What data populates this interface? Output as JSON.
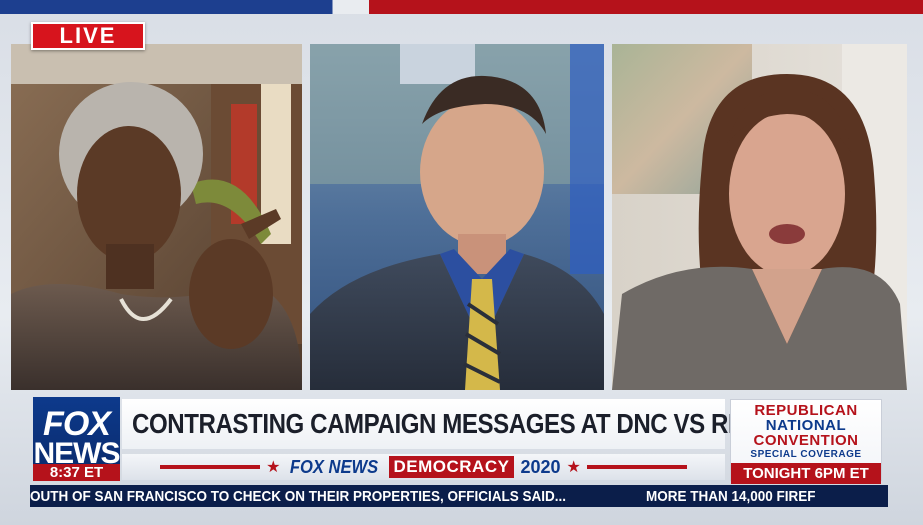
{
  "live": "LIVE",
  "lower_third": {
    "logo_line1": "FOX",
    "logo_line2": "NEWS",
    "time": "8:37 ET",
    "headline": "CONTRASTING CAMPAIGN MESSAGES AT DNC VS RNC",
    "brand": "FOX NEWS",
    "democracy": "DEMOCRACY",
    "year": "2020",
    "rnc_line1": "REPUBLICAN",
    "rnc_line2": "NATIONAL",
    "rnc_line3": "CONVENTION",
    "rnc_special": "SPECIAL COVERAGE",
    "rnc_tonight": "TONIGHT 6PM ET"
  },
  "ticker": {
    "item1": "OUTH OF SAN FRANCISCO TO CHECK ON THEIR PROPERTIES, OFFICIALS SAID...",
    "item2": "MORE THAN 14,000 FIREF"
  },
  "colors": {
    "fox_blue": "#0d3a8c",
    "fox_red": "#b5121b",
    "ticker_bg": "#0b1e4a"
  }
}
